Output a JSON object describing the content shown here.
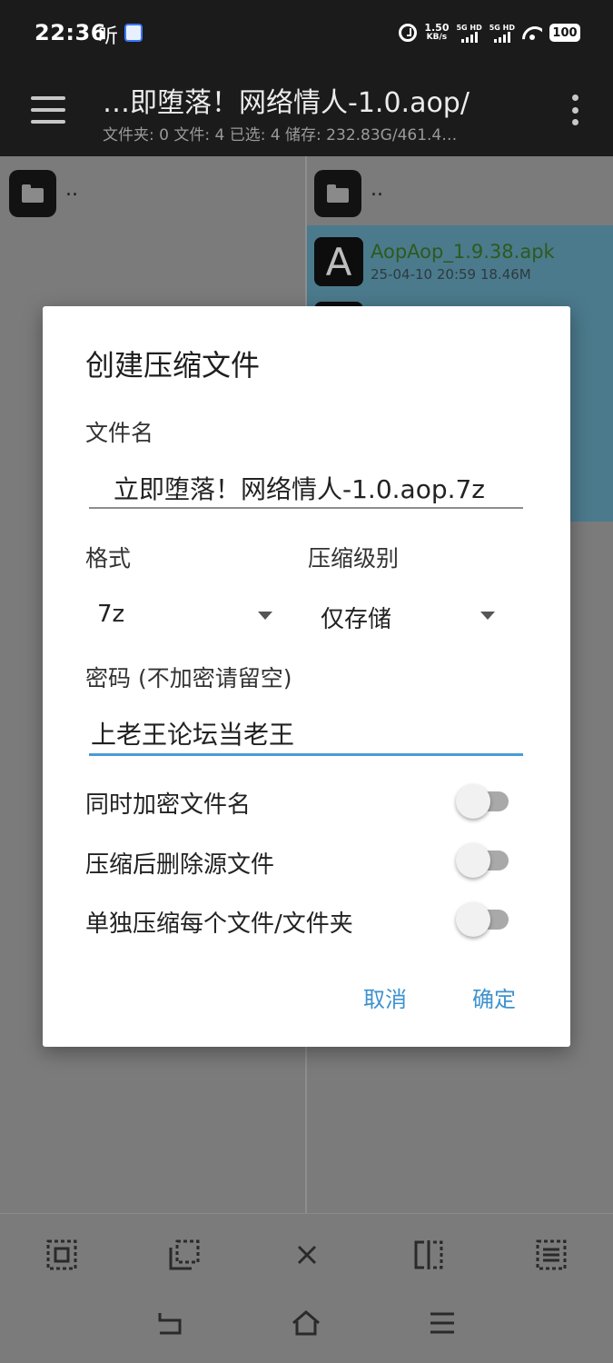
{
  "status_bar": {
    "time": "22:36",
    "ting_label": "听",
    "speed_value": "1.50",
    "speed_unit": "KB/s",
    "sim1_label": "5G HD",
    "sim2_label": "5G HD",
    "battery": "100"
  },
  "app_bar": {
    "path_title": "…即堕落！网络情人-1.0.aop/",
    "path_summary": "文件夹: 0  文件: 4  已选: 4  储存: 232.83G/461.4…"
  },
  "left_pane": {
    "parent_label": ".."
  },
  "right_pane": {
    "parent_label": "..",
    "files": [
      {
        "name": "AopAop_1.9.38.apk",
        "info": "25-04-10 20:59  18.46M",
        "icon_letter": "A"
      }
    ]
  },
  "dialog": {
    "title": "创建压缩文件",
    "filename_label": "文件名",
    "filename_value": "立即堕落！网络情人-1.0.aop.7z",
    "format_label": "格式",
    "format_value": "7z",
    "level_label": "压缩级别",
    "level_value": "仅存储",
    "password_label": "密码 (不加密请留空)",
    "password_value": "上老王论坛当老王",
    "options": [
      {
        "label": "同时加密文件名",
        "enabled": false
      },
      {
        "label": "压缩后删除源文件",
        "enabled": false
      },
      {
        "label": "单独压缩每个文件/文件夹",
        "enabled": false
      }
    ],
    "cancel_label": "取消",
    "ok_label": "确定"
  },
  "colors": {
    "accent": "#3e92cf",
    "selection": "#4b7a8c",
    "dim_background": "#7b7b7b",
    "toolbar": "#1b1b1b"
  },
  "icons": {
    "toolbar": [
      "select-all-icon",
      "select-range-icon",
      "close-icon",
      "compare-split-icon",
      "list-view-icon"
    ],
    "nav": [
      "back-icon",
      "home-icon",
      "menu-icon"
    ]
  }
}
